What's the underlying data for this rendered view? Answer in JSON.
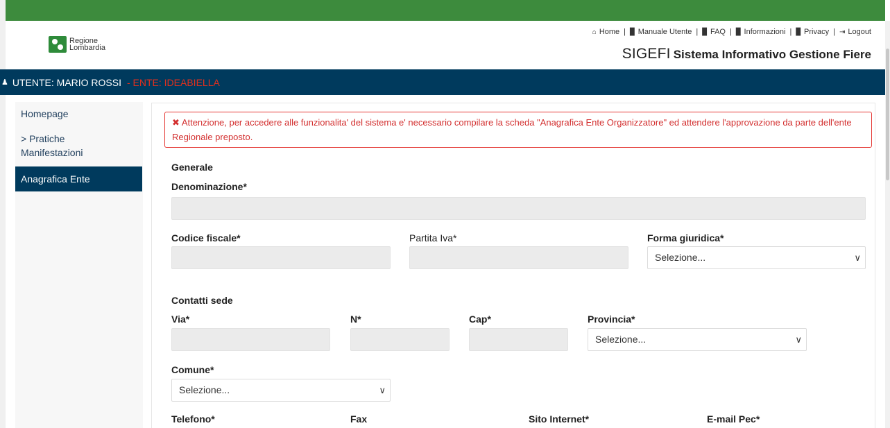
{
  "header": {
    "logo_text_line1": "Regione",
    "logo_text_line2": "Lombardia",
    "links": [
      {
        "icon": "home-icon",
        "glyph": "⌂",
        "label": "Home"
      },
      {
        "icon": "document-icon",
        "glyph": "▉",
        "label": "Manuale Utente"
      },
      {
        "icon": "faq-icon",
        "glyph": "▉",
        "label": "FAQ"
      },
      {
        "icon": "info-icon",
        "glyph": "▉",
        "label": "Informazioni"
      },
      {
        "icon": "privacy-icon",
        "glyph": "▉",
        "label": "Privacy"
      },
      {
        "icon": "logout-icon",
        "glyph": "⇥",
        "label": "Logout"
      }
    ],
    "app_short": "SIGEFI",
    "app_long": "Sistema Informativo Gestione Fiere"
  },
  "userbar": {
    "user_label": "UTENTE: MARIO ROSSI",
    "ente_label": "- ENTE: IDEABIELLA"
  },
  "sidebar": {
    "items": [
      {
        "label": "Homepage"
      },
      {
        "label": "> Pratiche"
      },
      {
        "label": "Manifestazioni"
      },
      {
        "label": "Anagrafica Ente"
      }
    ]
  },
  "alert": {
    "icon": "✖",
    "text": "Attenzione, per accedere alle funzionalita' del sistema e' necessario compilare la scheda \"Anagrafica Ente Organizzatore\" ed attendere l'approvazione da parte dell'ente Regionale preposto."
  },
  "form": {
    "section_generale": "Generale",
    "denominazione_label": "Denominazione*",
    "codice_fiscale_label": "Codice fiscale*",
    "partita_iva_label": "Partita Iva*",
    "forma_giuridica_label": "Forma giuridica*",
    "forma_giuridica_value": "Selezione...",
    "section_contatti": "Contatti sede",
    "via_label": "Via*",
    "numero_label": "N*",
    "cap_label": "Cap*",
    "provincia_label": "Provincia*",
    "provincia_value": "Selezione...",
    "comune_label": "Comune*",
    "comune_value": "Selezione...",
    "telefono_label": "Telefono*",
    "fax_label": "Fax",
    "sito_label": "Sito Internet*",
    "email_pec_label": "E-mail Pec*"
  },
  "colors": {
    "topbar": "#3d8b3d",
    "userbar": "#003a5d",
    "alert": "#e53935"
  }
}
